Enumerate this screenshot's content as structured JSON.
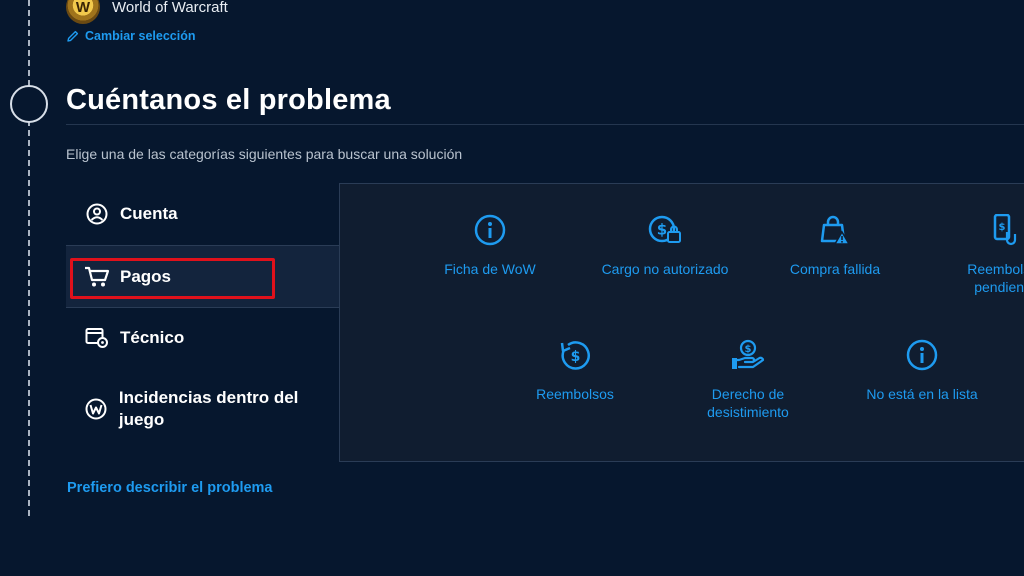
{
  "header": {
    "game_name": "World of Warcraft",
    "game_logo_letter": "W",
    "change_selection": "Cambiar selección"
  },
  "main": {
    "title": "Cuéntanos el problema",
    "subtitle": "Elige una de las categorías siguientes para buscar una solución",
    "categories": [
      {
        "label": "Cuenta",
        "icon": "user-circle-icon",
        "selected": false
      },
      {
        "label": "Pagos",
        "icon": "shopping-cart-icon",
        "selected": true
      },
      {
        "label": "Técnico",
        "icon": "monitor-gear-icon",
        "selected": false
      },
      {
        "label": "Incidencias dentro del juego",
        "icon": "wow-logo-icon",
        "selected": false
      }
    ],
    "options": [
      {
        "label": "Ficha de WoW",
        "icon": "info-circle-icon"
      },
      {
        "label": "Cargo no autorizado",
        "icon": "dollar-lock-icon"
      },
      {
        "label": "Compra fallida",
        "icon": "bag-warning-icon"
      },
      {
        "label": "Reembolsar pendiente",
        "icon": "phone-touch-icon"
      },
      {
        "label": "Reembolsos",
        "icon": "refund-dollar-icon"
      },
      {
        "label": "Derecho de desistimiento",
        "icon": "hand-dollar-icon"
      },
      {
        "label": "No está en la lista",
        "icon": "info-circle-icon"
      }
    ],
    "describe_link": "Prefiero describir el problema"
  },
  "colors": {
    "background": "#06172e",
    "panel": "#101d30",
    "accent": "#1e9bf0",
    "highlight": "#e0111b"
  }
}
